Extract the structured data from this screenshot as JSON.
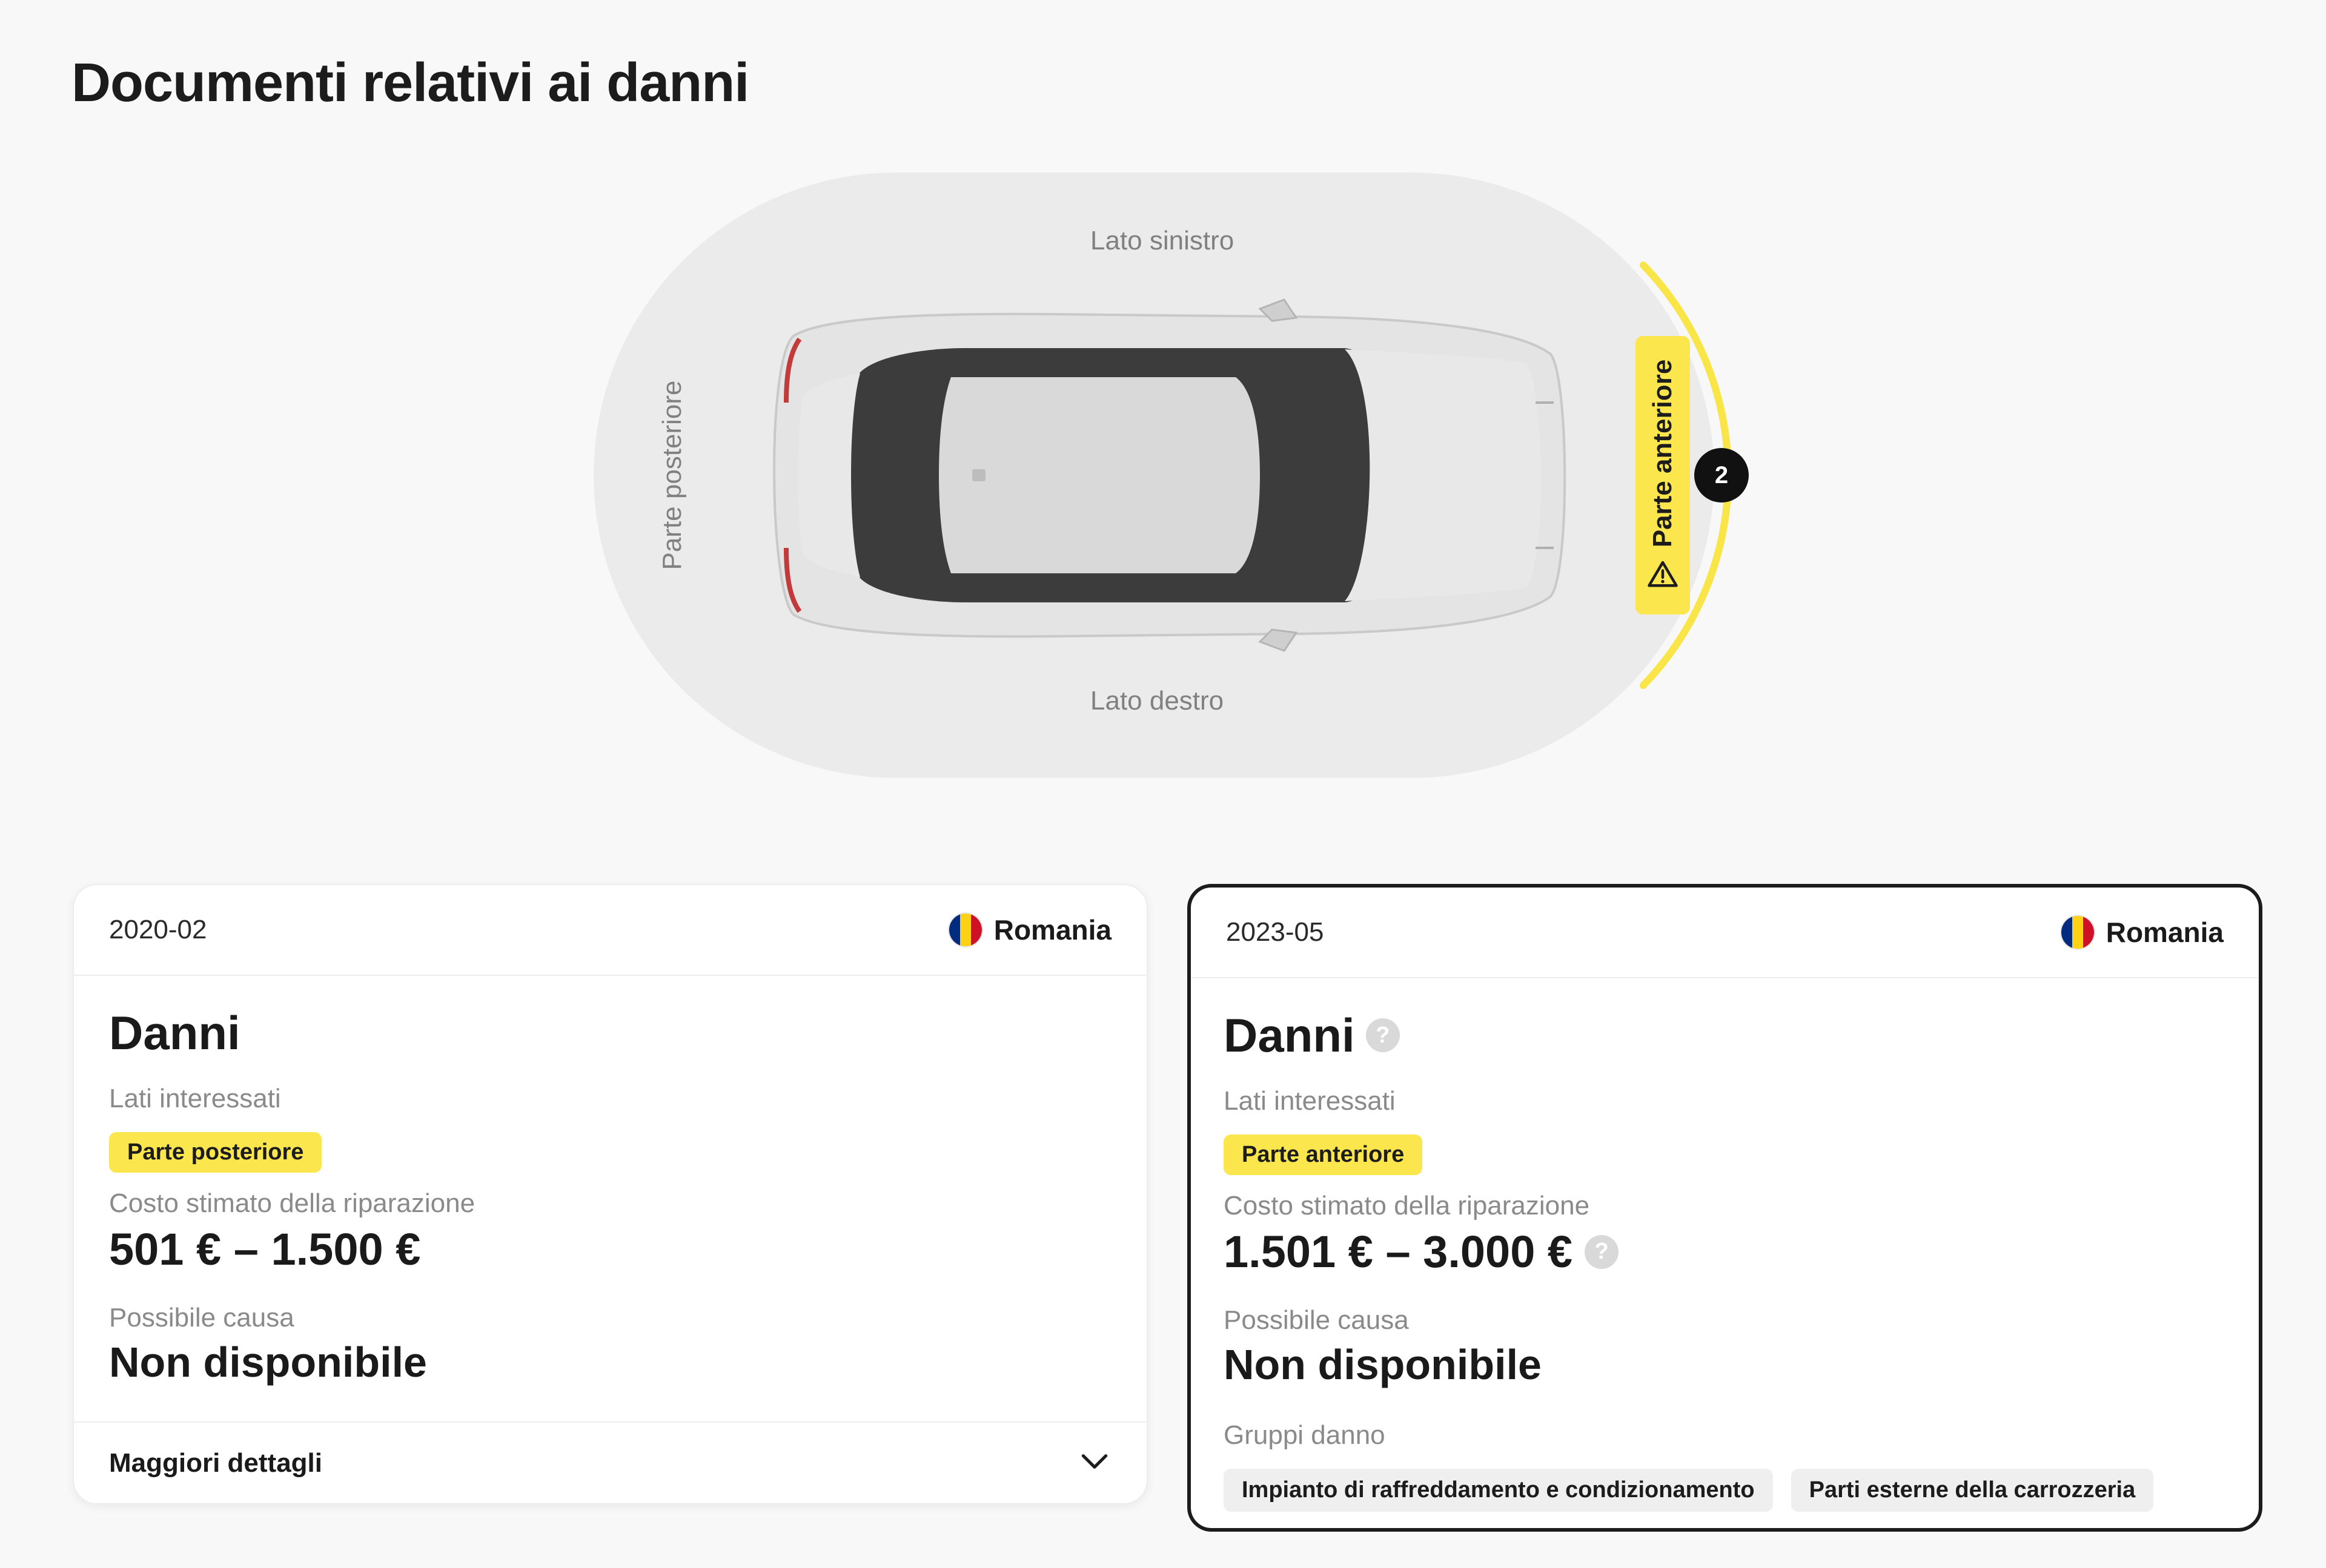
{
  "page": {
    "title": "Documenti relativi ai danni"
  },
  "diagram": {
    "label_left_side": "Lato sinistro",
    "label_right_side": "Lato destro",
    "label_rear": "Parte posteriore",
    "label_front": "Parte anteriore",
    "front_damage_count": "2",
    "highlight_color": "#f9e547"
  },
  "records": [
    {
      "date": "2020-02",
      "country": "Romania",
      "title": "Danni",
      "sides_label": "Lati interessati",
      "side": "Parte posteriore",
      "cost_label": "Costo stimato della riparazione",
      "cost": "501 € – 1.500 €",
      "cause_label": "Possibile causa",
      "cause": "Non disponibile",
      "more_details": "Maggiori dettagli"
    },
    {
      "date": "2023-05",
      "country": "Romania",
      "title": "Danni",
      "sides_label": "Lati interessati",
      "side": "Parte anteriore",
      "cost_label": "Costo stimato della riparazione",
      "cost": "1.501 € – 3.000 €",
      "cause_label": "Possibile causa",
      "cause": "Non disponibile",
      "groups_label": "Gruppi danno",
      "groups": [
        "Impianto di raffreddamento e condizionamento",
        "Parti esterne della carrozzeria"
      ],
      "selected": true
    }
  ],
  "flag_colors": [
    "#002b7f",
    "#fcd116",
    "#ce1126"
  ],
  "icons": {
    "help": "?",
    "chevron": "chevron-down-icon",
    "warning": "warning-icon"
  }
}
